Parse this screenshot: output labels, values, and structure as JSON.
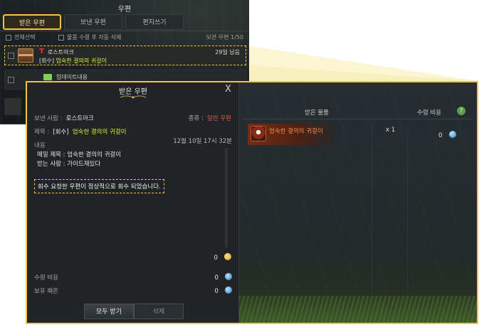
{
  "mailbox": {
    "title": "우편",
    "tabs": [
      {
        "label": "받은 우편"
      },
      {
        "label": "보낸 우편"
      },
      {
        "label": "편지쓰기"
      }
    ],
    "select_all": "전체선택",
    "auto_delete": "물품 수령 후 자동 삭제",
    "storage_count": "보관 우편 1/50",
    "mails": [
      {
        "sender": "로스트아크",
        "days_left": "29일 남음",
        "subject_tag": "[회수]",
        "subject": "엄숙한 결의의 귀걸이"
      },
      {
        "subject": "업데이트내용"
      }
    ]
  },
  "dialog": {
    "title": "받은 우편",
    "sender_label": "보낸 사람 :",
    "sender": "로스트아크",
    "type_label": "종류 :",
    "type": "일반 우편",
    "subject_label": "제목 :",
    "subject_tag": "[회수]",
    "subject": "엄숙한 결의의 귀걸이",
    "content_label": "내용",
    "date": "12월 10일 17시 32분",
    "body_line1": "메일 제목 : 엄숙한 결의의 귀걸이",
    "body_line2": "받는 사람 : 가이드재있다",
    "notice": "회수 요청한 우편이 정상적으로 회수 되었습니다.",
    "gold_value": "0",
    "fee_label": "수령 비용",
    "fee_value": "0",
    "own_label": "보유 패온",
    "own_value": "0",
    "receive_all": "모두 받기",
    "delete": "삭제",
    "close_glyph": "X",
    "items_header": "받은 물품",
    "fee_header": "수령 비용",
    "help_glyph": "?",
    "items": [
      {
        "name": "엄숙한 결의의 귀걸이",
        "qty": "x 1",
        "fee": "0"
      }
    ]
  },
  "colors": {
    "highlight": "#f3c53a",
    "item_name": "#ff8a45",
    "subject_accent": "#d7ef3e",
    "type_accent": "#e35c38"
  },
  "icons": [
    "treasure-chest-icon",
    "lost-ark-logo-icon",
    "envelope-icon",
    "close-icon",
    "help-icon",
    "gold-coin-icon",
    "pheon-icon",
    "earring-item-icon"
  ]
}
